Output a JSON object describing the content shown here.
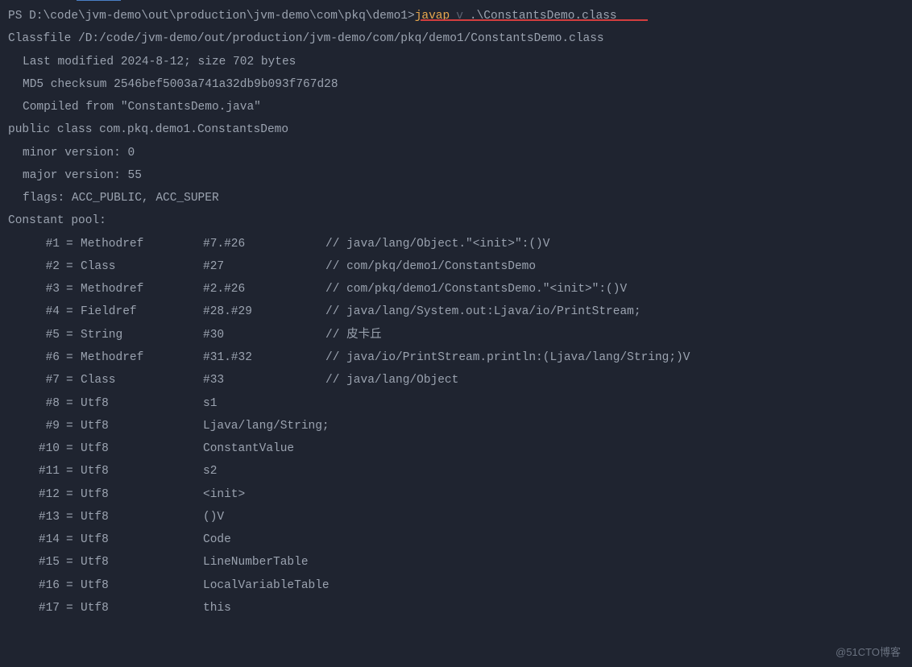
{
  "prompt": {
    "path": "PS D:\\code\\jvm-demo\\out\\production\\jvm-demo\\com\\pkq\\demo1> ",
    "cmd": "javap",
    "flag": "v",
    "arg": ".\\ConstantsDemo.class"
  },
  "header": {
    "classfile": "Classfile /D:/code/jvm-demo/out/production/jvm-demo/com/pkq/demo1/ConstantsDemo.class",
    "last_modified": "Last modified 2024-8-12; size 702 bytes",
    "md5": "MD5 checksum 2546bef5003a741a32db9b093f767d28",
    "compiled_from": "Compiled from \"ConstantsDemo.java\"",
    "class_decl": "public class com.pkq.demo1.ConstantsDemo",
    "minor": "minor version: 0",
    "major": "major version: 55",
    "flags": "flags: ACC_PUBLIC, ACC_SUPER",
    "pool_label": "Constant pool:"
  },
  "pool": [
    {
      "idx": "#1",
      "type": "Methodref",
      "val": "#7.#26",
      "comment": "// java/lang/Object.\"<init>\":()V"
    },
    {
      "idx": "#2",
      "type": "Class",
      "val": "#27",
      "comment": "// com/pkq/demo1/ConstantsDemo"
    },
    {
      "idx": "#3",
      "type": "Methodref",
      "val": "#2.#26",
      "comment": "// com/pkq/demo1/ConstantsDemo.\"<init>\":()V"
    },
    {
      "idx": "#4",
      "type": "Fieldref",
      "val": "#28.#29",
      "comment": "// java/lang/System.out:Ljava/io/PrintStream;"
    },
    {
      "idx": "#5",
      "type": "String",
      "val": "#30",
      "comment": "// 皮卡丘"
    },
    {
      "idx": "#6",
      "type": "Methodref",
      "val": "#31.#32",
      "comment": "// java/io/PrintStream.println:(Ljava/lang/String;)V"
    },
    {
      "idx": "#7",
      "type": "Class",
      "val": "#33",
      "comment": "// java/lang/Object"
    },
    {
      "idx": "#8",
      "type": "Utf8",
      "val": "s1",
      "comment": ""
    },
    {
      "idx": "#9",
      "type": "Utf8",
      "val": "Ljava/lang/String;",
      "comment": ""
    },
    {
      "idx": "#10",
      "type": "Utf8",
      "val": "ConstantValue",
      "comment": ""
    },
    {
      "idx": "#11",
      "type": "Utf8",
      "val": "s2",
      "comment": ""
    },
    {
      "idx": "#12",
      "type": "Utf8",
      "val": "<init>",
      "comment": ""
    },
    {
      "idx": "#13",
      "type": "Utf8",
      "val": "()V",
      "comment": ""
    },
    {
      "idx": "#14",
      "type": "Utf8",
      "val": "Code",
      "comment": ""
    },
    {
      "idx": "#15",
      "type": "Utf8",
      "val": "LineNumberTable",
      "comment": ""
    },
    {
      "idx": "#16",
      "type": "Utf8",
      "val": "LocalVariableTable",
      "comment": ""
    },
    {
      "idx": "#17",
      "type": "Utf8",
      "val": "this",
      "comment": ""
    }
  ],
  "watermark": "@51CTO博客"
}
